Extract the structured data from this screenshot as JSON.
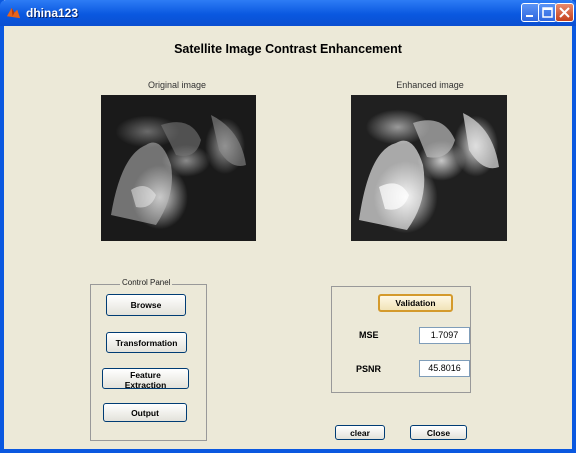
{
  "window": {
    "title": "dhina123",
    "icon": "matlab-icon"
  },
  "heading": "Satellite Image Contrast Enhancement",
  "images": {
    "original_label": "Original image",
    "enhanced_label": "Enhanced image"
  },
  "control_panel": {
    "title": "Control Panel",
    "browse": "Browse",
    "transformation": "Transformation",
    "feature_extraction": "Feature Extraction",
    "output": "Output"
  },
  "validation": {
    "button": "Validation",
    "mse_label": "MSE",
    "mse_value": "1.7097",
    "psnr_label": "PSNR",
    "psnr_value": "45.8016"
  },
  "actions": {
    "clear": "clear",
    "close": "Close"
  },
  "colors": {
    "titlebar": "#0a58e0",
    "background": "#ece9d8",
    "focus_border": "#d49a2c"
  }
}
